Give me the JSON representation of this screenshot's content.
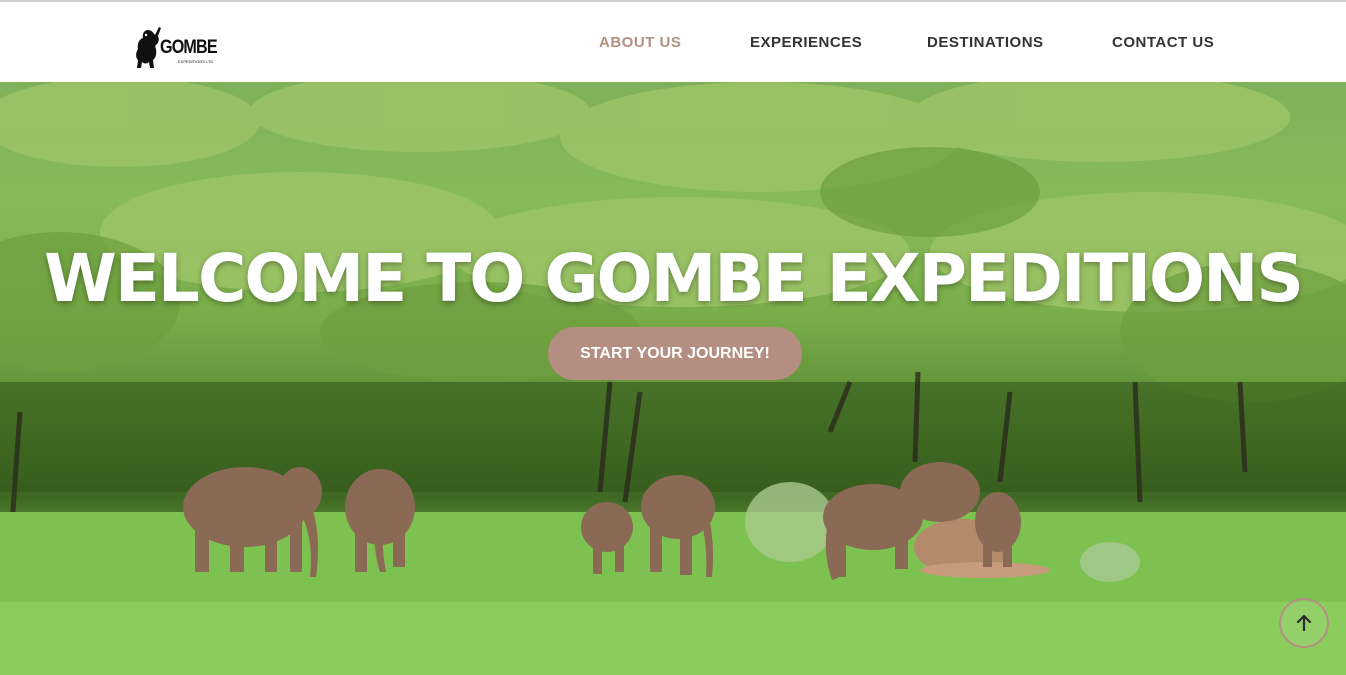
{
  "brand": {
    "logo_text": "GOMBE",
    "logo_subtext": "EXPEDITIONS LTD"
  },
  "nav": {
    "items": [
      {
        "label": "ABOUT US",
        "active": true
      },
      {
        "label": "EXPERIENCES",
        "active": false
      },
      {
        "label": "DESTINATIONS",
        "active": false
      },
      {
        "label": "CONTACT US",
        "active": false
      }
    ]
  },
  "hero": {
    "title": "WELCOME TO GOMBE EXPEDITIONS",
    "cta_label": "START YOUR JOURNEY!",
    "scroll_icon": "arrow-up-icon"
  },
  "colors": {
    "accent": "#b48f81",
    "nav_text": "#333333",
    "hero_text": "#ffffff"
  }
}
